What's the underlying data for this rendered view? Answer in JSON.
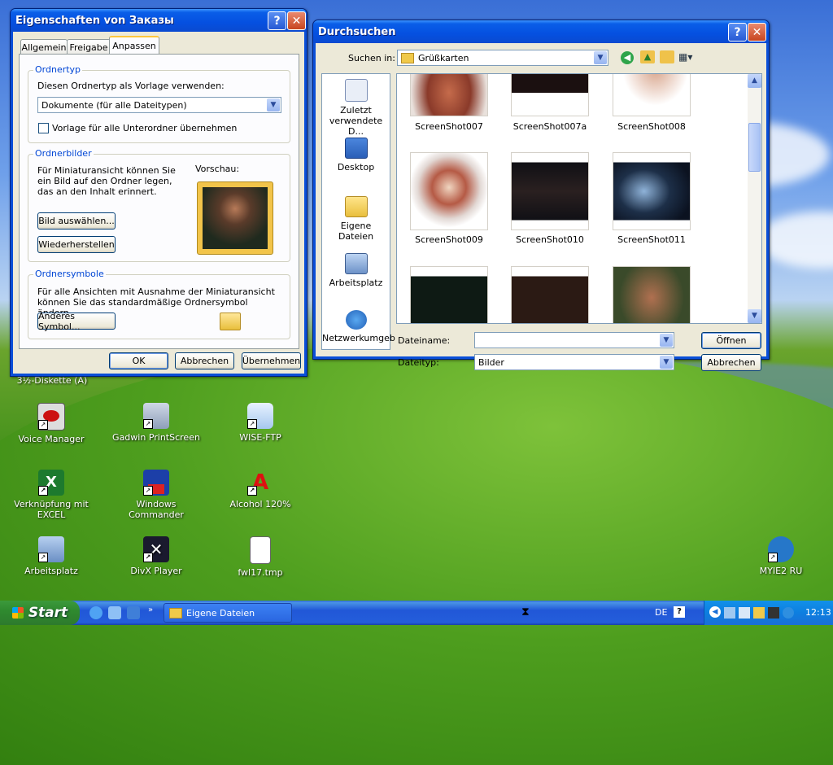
{
  "desktop": {
    "icons": [
      {
        "label": "3½-Diskette (A)",
        "name": "floppy"
      },
      {
        "label": "Voice Manager",
        "name": "voice-manager"
      },
      {
        "label": "Gadwin PrintScreen",
        "name": "gadwin-printscreen"
      },
      {
        "label": "WISE-FTP",
        "name": "wise-ftp"
      },
      {
        "label": "Verknüpfung mit EXCEL",
        "name": "excel"
      },
      {
        "label": "Windows Commander",
        "name": "windows-commander"
      },
      {
        "label": "Alcohol 120%",
        "name": "alcohol"
      },
      {
        "label": "Arbeitsplatz",
        "name": "my-computer"
      },
      {
        "label": "DivX Player",
        "name": "divx"
      },
      {
        "label": "fwl17.tmp",
        "name": "tmp-file"
      },
      {
        "label": "MYIE2 RU",
        "name": "myie2"
      }
    ]
  },
  "props": {
    "title": "Eigenschaften von Заказы",
    "tabs": [
      "Allgemein",
      "Freigabe",
      "Anpassen"
    ],
    "ordnertyp": {
      "title": "Ordnertyp",
      "label": "Diesen Ordnertyp als Vorlage verwenden:",
      "value": "Dokumente (für alle Dateitypen)",
      "checkbox": "Vorlage für alle Unterordner übernehmen"
    },
    "ordnerbilder": {
      "title": "Ordnerbilder",
      "text": "Für Miniaturansicht können Sie ein Bild auf den Ordner legen, das an den Inhalt erinnert.",
      "preview": "Vorschau:",
      "btn_choose": "Bild auswählen...",
      "btn_restore": "Wiederherstellen"
    },
    "ordnersymbole": {
      "title": "Ordnersymbole",
      "text": "Für alle Ansichten mit Ausnahme der Miniaturansicht können Sie das standardmäßige Ordnersymbol ändern.",
      "btn": "Anderes Symbol..."
    },
    "ok": "OK",
    "cancel": "Abbrechen",
    "apply": "Übernehmen"
  },
  "browse": {
    "title": "Durchsuchen",
    "lookin_label": "Suchen in:",
    "lookin_value": "Grüßkarten",
    "places": [
      "Zuletzt verwendete D...",
      "Desktop",
      "Eigene Dateien",
      "Arbeitsplatz",
      "Netzwerkumgeb"
    ],
    "files": [
      "ScreenShot007",
      "ScreenShot007a",
      "ScreenShot008",
      "ScreenShot009",
      "ScreenShot010",
      "ScreenShot011"
    ],
    "filename_label": "Dateiname:",
    "filename_value": "",
    "filetype_label": "Dateityp:",
    "filetype_value": "Bilder",
    "open": "Öffnen",
    "cancel": "Abbrechen"
  },
  "taskbar": {
    "start": "Start",
    "task": "Eigene Dateien",
    "lang": "DE",
    "clock": "12:13"
  },
  "colors": {
    "accent": "#0a4fd8",
    "start_green": "#2f8a2f",
    "group_title": "#0046d5"
  }
}
